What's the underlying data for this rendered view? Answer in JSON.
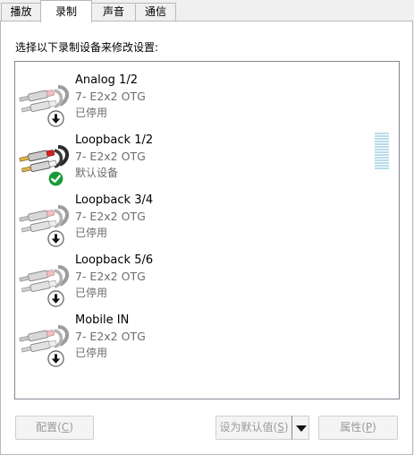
{
  "tabs": [
    {
      "label": "播放",
      "active": false
    },
    {
      "label": "录制",
      "active": true
    },
    {
      "label": "声音",
      "active": false
    },
    {
      "label": "通信",
      "active": false
    }
  ],
  "instruction": "选择以下录制设备来修改设置:",
  "devices": [
    {
      "name": "Analog 1/2",
      "driver": "7- E2x2 OTG",
      "status": "已停用",
      "badge": "down-arrow-icon"
    },
    {
      "name": "Loopback 1/2",
      "driver": "7- E2x2 OTG",
      "status": "默认设备",
      "badge": "checkmark-icon"
    },
    {
      "name": "Loopback 3/4",
      "driver": "7- E2x2 OTG",
      "status": "已停用",
      "badge": "down-arrow-icon"
    },
    {
      "name": "Loopback 5/6",
      "driver": "7- E2x2 OTG",
      "status": "已停用",
      "badge": "down-arrow-icon"
    },
    {
      "name": "Mobile IN",
      "driver": "7- E2x2 OTG",
      "status": "已停用",
      "badge": "down-arrow-icon"
    }
  ],
  "buttons": {
    "configure": {
      "label": "配置(",
      "key": "C",
      "suffix": ")"
    },
    "set_default": {
      "label": "设为默认值(",
      "key": "S",
      "suffix": ")"
    },
    "properties": {
      "label": "属性(",
      "key": "P",
      "suffix": ")"
    }
  },
  "colors": {
    "accent_check": "#1a9a3a",
    "meter": "#b7dde7",
    "disabled_text": "#9a9a9a"
  }
}
